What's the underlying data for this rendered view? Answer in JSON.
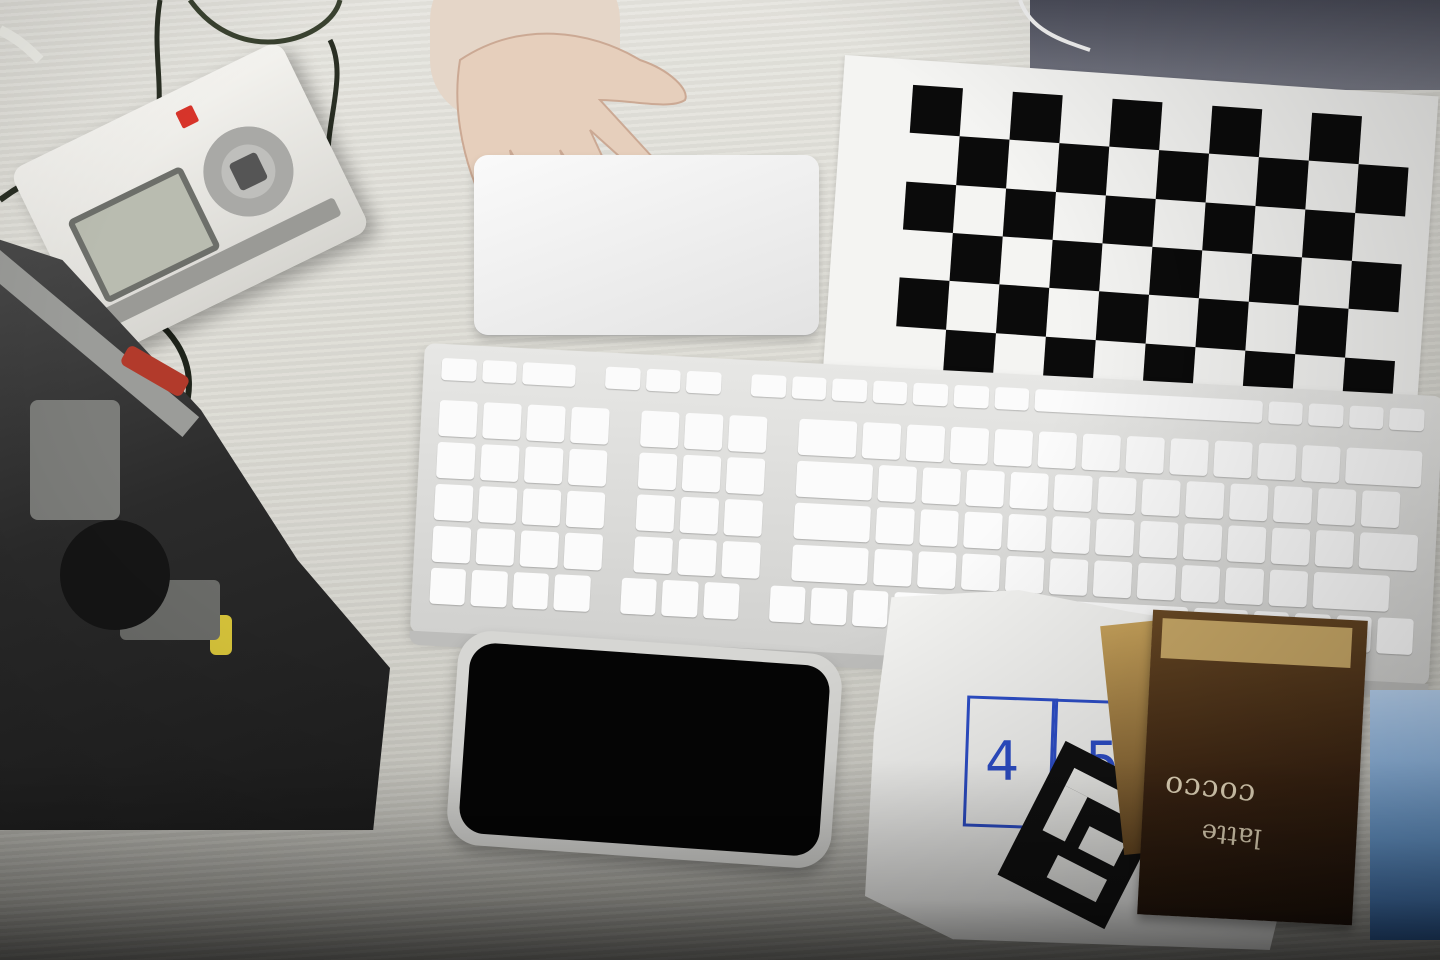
{
  "scene": {
    "description_objects": [
      "robot-controller",
      "robot-frame",
      "trackpad",
      "hand",
      "checkerboard",
      "keyboard",
      "phone",
      "napkin",
      "marker",
      "coffee-packet"
    ],
    "colors": {
      "desk": "#dcdbd4",
      "checker_black": "#0b0b0b",
      "ink_blue": "#2d4ec8",
      "packet_brown": "#3b2412"
    }
  },
  "napkin": {
    "digit": "4",
    "digit2": "5"
  },
  "packet": {
    "brand_line1": "cocco",
    "brand_line2": "latte"
  }
}
